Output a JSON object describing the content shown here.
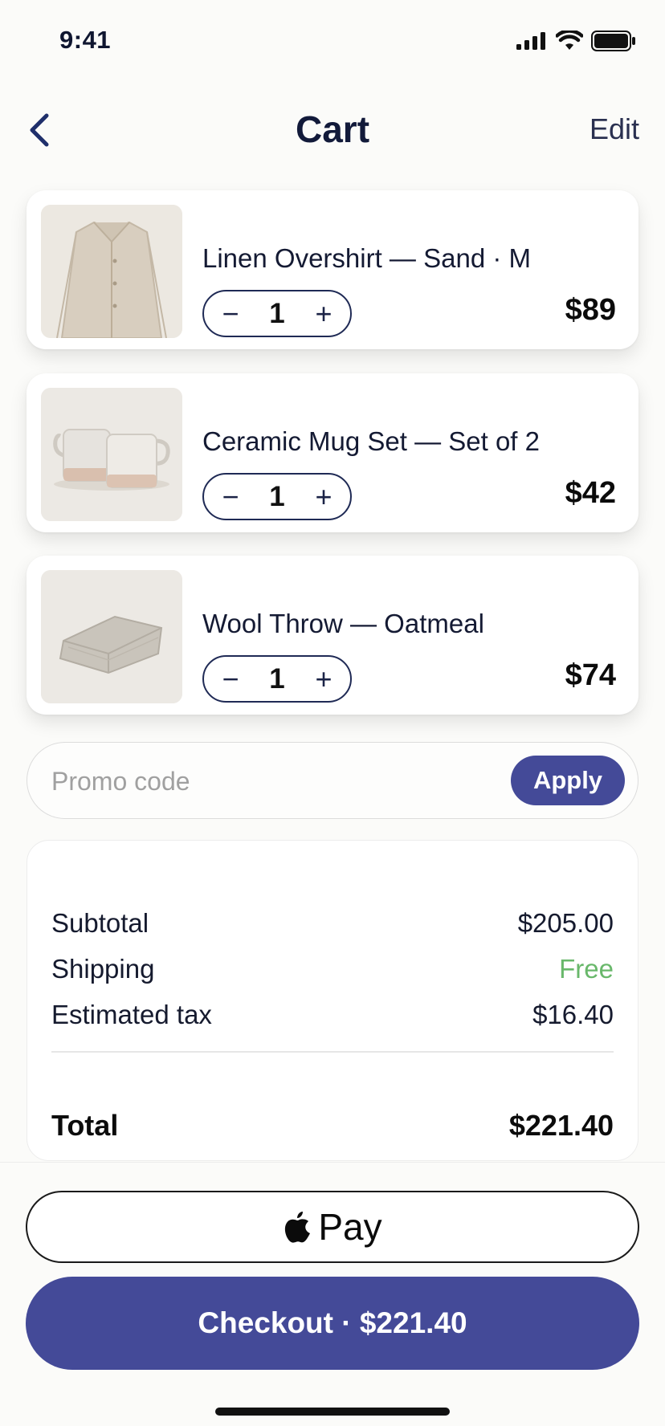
{
  "status_bar": {
    "time": "9:41",
    "icons": [
      "signal-icon",
      "wifi-icon",
      "battery-icon"
    ]
  },
  "nav": {
    "back_icon": "chevron-left-icon",
    "title": "Cart",
    "edit_label": "Edit"
  },
  "items": [
    {
      "name": "Linen Overshirt — Sand · M",
      "qty": "1",
      "price": "$89",
      "thumb_icon": "shirt-icon"
    },
    {
      "name": "Ceramic Mug Set — Set of 2",
      "qty": "1",
      "price": "$42",
      "thumb_icon": "mugs-icon"
    },
    {
      "name": "Wool Throw — Oatmeal",
      "qty": "1",
      "price": "$74",
      "thumb_icon": "blanket-icon"
    }
  ],
  "stepper": {
    "minus": "−",
    "plus": "+"
  },
  "promo": {
    "placeholder": "Promo code",
    "value": "",
    "apply_label": "Apply"
  },
  "summary": {
    "subtotal_label": "Subtotal",
    "subtotal_value": "$205.00",
    "shipping_label": "Shipping",
    "shipping_value": "Free",
    "tax_label": "Estimated tax",
    "tax_value": "$16.40",
    "total_label": "Total",
    "total_value": "$221.40"
  },
  "actions": {
    "applepay_label": "Pay",
    "checkout_label": "Checkout · $221.40"
  },
  "colors": {
    "accent": "#444a98",
    "free_green": "#69b86b",
    "background": "#fbfbf9"
  }
}
